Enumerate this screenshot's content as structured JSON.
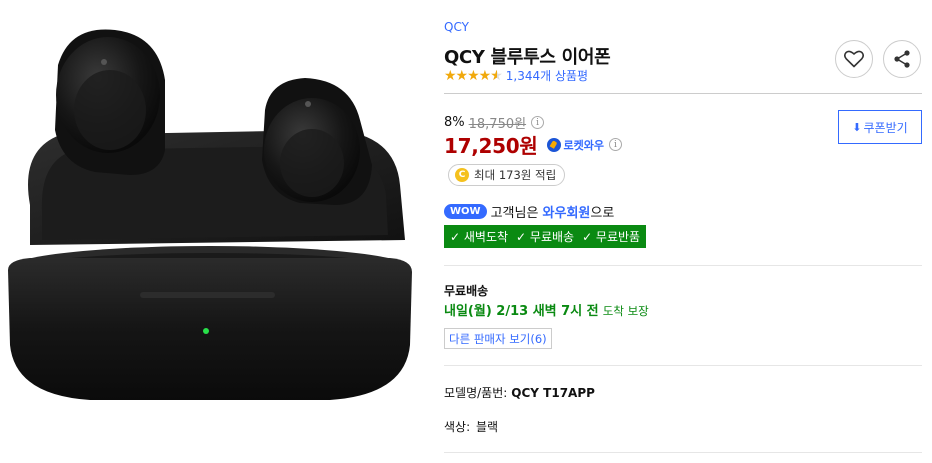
{
  "product": {
    "brand": "QCY",
    "title": "QCY 블루투스 이어폰",
    "rating_value": 4.5,
    "review_count": "1,344개 상품평"
  },
  "pricing": {
    "discount_rate": "8%",
    "original_price": "18,750원",
    "sale_price": "17,250원",
    "rocket_label": "로켓와우",
    "info_glyph": "i"
  },
  "coupon": {
    "label": "쿠폰받기"
  },
  "cashback": {
    "coin_glyph": "C",
    "text": "최대 173원 적립"
  },
  "wow": {
    "badge": "WOW",
    "prefix": "고객님은",
    "link": "와우회원",
    "suffix": "으로"
  },
  "benefits": [
    "✓ 새벽도착",
    "✓ 무료배송",
    "✓ 무료반품"
  ],
  "shipping": {
    "label": "무료배송",
    "arrival_main": "내일(월) 2/13 새벽 7시 전",
    "arrival_suffix": "도착 보장",
    "other_sellers": "다른 판매자 보기(6)"
  },
  "specs": {
    "model_label": "모델명/품번:",
    "model_value": "QCY T17APP",
    "color_label": "색상:",
    "color_value": "블랙"
  },
  "colors": {
    "accent_blue": "#346aff",
    "price_red": "#ae0000",
    "star_orange": "#f1a90c",
    "benefit_green": "#0a8a12"
  },
  "icons": {
    "heart": "heart-icon",
    "share": "share-icon",
    "download": "download-icon"
  }
}
